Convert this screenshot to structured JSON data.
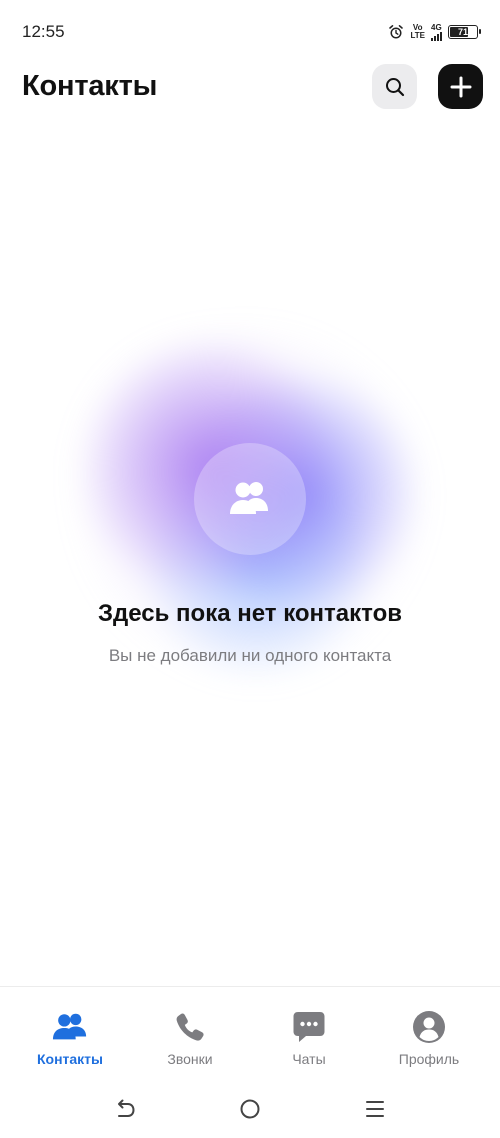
{
  "status_bar": {
    "time": "12:55",
    "volte_top": "Vo",
    "volte_bottom": "LTE",
    "network": "4G",
    "battery": "71"
  },
  "header": {
    "title": "Контакты",
    "search_icon": "search-icon",
    "add_icon": "plus-icon"
  },
  "empty_state": {
    "icon": "people-icon",
    "title": "Здесь пока нет контактов",
    "subtitle": "Вы не добавили ни одного контакта"
  },
  "tabs": [
    {
      "label": "Контакты",
      "icon": "people-icon",
      "active": true
    },
    {
      "label": "Звонки",
      "icon": "phone-icon",
      "active": false
    },
    {
      "label": "Чаты",
      "icon": "chat-icon",
      "active": false
    },
    {
      "label": "Профиль",
      "icon": "profile-icon",
      "active": false
    }
  ],
  "colors": {
    "accent": "#1f6fde",
    "inactive": "#7c7c80",
    "add_button": "#111111",
    "search_button_bg": "#ececee"
  },
  "nav_bar": {
    "back_icon": "back-icon",
    "home_icon": "home-icon",
    "menu_icon": "menu-icon"
  }
}
